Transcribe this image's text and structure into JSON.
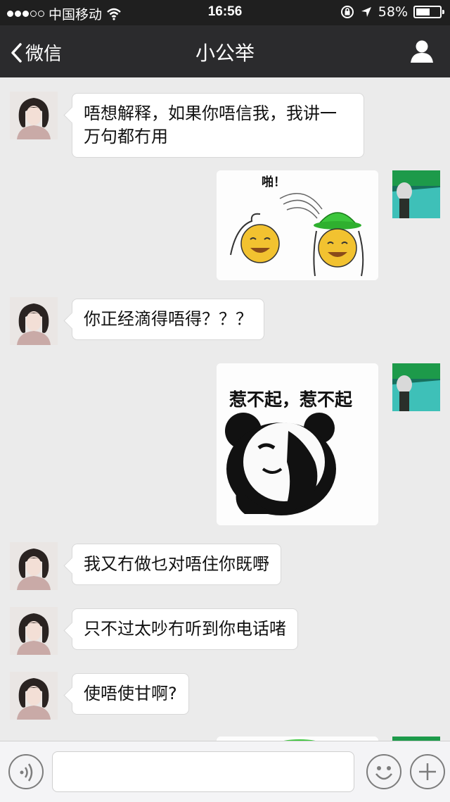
{
  "status_bar": {
    "carrier": "中国移动",
    "time": "16:56",
    "battery_percent": "58%",
    "battery_level": 0.58,
    "icons": [
      "signal-dots-icon",
      "wifi-icon",
      "rotation-lock-icon",
      "location-arrow-icon",
      "battery-icon"
    ]
  },
  "nav": {
    "back_label": "微信",
    "title": "小公举",
    "profile_icon": "person-icon"
  },
  "messages": [
    {
      "side": "left",
      "type": "text",
      "text": "唔想解释，如果你唔信我，我讲一万句都冇用"
    },
    {
      "side": "right",
      "type": "sticker",
      "sticker": "green-hat-smileys",
      "caption": "啪！"
    },
    {
      "side": "left",
      "type": "text",
      "text": "你正经滴得唔得？？？"
    },
    {
      "side": "right",
      "type": "sticker",
      "sticker": "panda-face",
      "caption": "惹不起，惹不起"
    },
    {
      "side": "left",
      "type": "text",
      "text": "我又冇做乜对唔住你既嘢"
    },
    {
      "side": "left",
      "type": "text",
      "text": "只不过太吵冇听到你电话啫"
    },
    {
      "side": "left",
      "type": "text",
      "text": "使唔使甘啊?"
    }
  ],
  "input_bar": {
    "voice_icon": "voice-icon",
    "text_value": "",
    "emoji_icon": "emoji-icon",
    "plus_icon": "plus-icon"
  },
  "colors": {
    "nav_bg": "#2b2b2d",
    "chat_bg": "#ebebeb",
    "bubble_bg": "#ffffff"
  }
}
